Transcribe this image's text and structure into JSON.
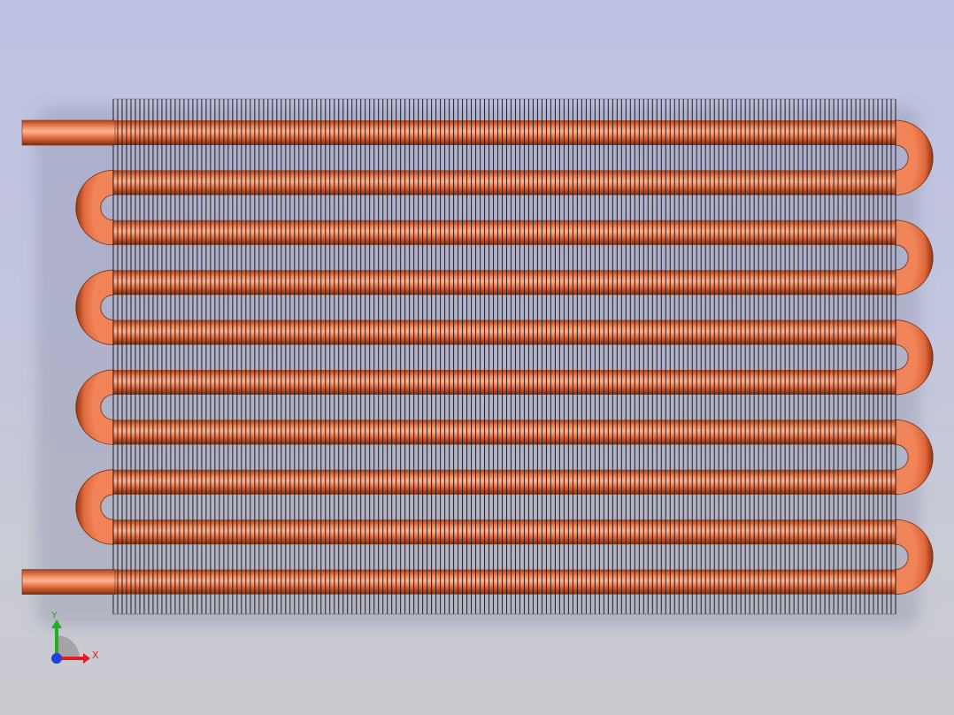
{
  "model": {
    "tube_passes": 10,
    "fin_count": 178,
    "colors": {
      "background_top": "#bfc2e3",
      "background_bottom": "#cacbd0",
      "copper_dark": "#8e3410",
      "copper_mid": "#e46a3e",
      "copper_light": "#ffb190",
      "fin": "#111111",
      "fin_gap": "#d6d8e4"
    }
  },
  "triad": {
    "x_label": "X",
    "y_label": "Y",
    "x_color": "#e02020",
    "y_color": "#20b020",
    "z_color": "#2040e0"
  }
}
